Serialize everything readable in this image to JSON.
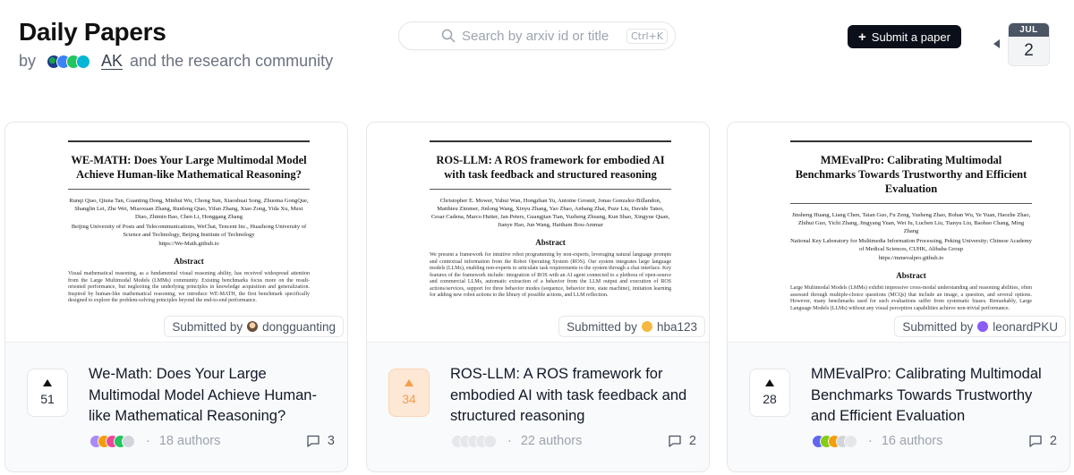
{
  "header": {
    "title": "Daily Papers",
    "by": "by",
    "ak": "AK",
    "community": "and the research community"
  },
  "search": {
    "placeholder": "Search by arxiv id or title",
    "shortcut": "Ctrl+K"
  },
  "submit_button": {
    "label": "Submit a paper"
  },
  "date": {
    "month": "JUL",
    "day": "2"
  },
  "papers": [
    {
      "thumb_title": "WE-MATH: Does Your Large Multimodal Model Achieve Human-like Mathematical Reasoning?",
      "thumb_authors": "Runqi Qiao, Qiuna Tan, Guanting Dong, Minhui Wu, Chong Sun, Xiaoshuai Song, Zhuoma GongQue, Shanglin Lei, Zhe Wei, Miaoxuan Zhang, Runfeng Qiao, Yifan Zhang, Xiao Zong, Yida Xu, Muxi Diao, Zhimin Bao, Chen Li, Honggang Zhang",
      "thumb_affil": "Beijing University of Posts and Telecommunications, WeChat, Tencent Inc., Huazhong University of Science and Technology, Beijing Institute of Technology",
      "thumb_link": "https://We-Math.github.io",
      "thumb_abstract_heading": "Abstract",
      "thumb_abstract": "Visual mathematical reasoning, as a fundamental visual reasoning ability, has received widespread attention from the Large Multimodal Models (LMMs) community. Existing benchmarks focus more on the result-oriented performance, but neglecting the underlying principles in knowledge acquisition and generalization. Inspired by human-like mathematical reasoning, we introduce WE-MATH, the first benchmark specifically designed to explore the problem-solving principles beyond the end-to-end performance.",
      "submitted_label": "Submitted by",
      "submitter": "dongguanting",
      "upvotes": "51",
      "title": "We-Math: Does Your Large Multimodal Model Achieve Human-like Mathematical Reasoning?",
      "authors": "18 authors",
      "comments": "3",
      "voted": false
    },
    {
      "thumb_title": "ROS-LLM: A ROS framework for embodied AI with task feedback and structured reasoning",
      "thumb_authors": "Christopher E. Mower, Yuhui Wan, Hongzhan Yu, Antoine Grosnit, Jonas Gonzalez-Billandon, Matthieu Zimmer, Jinlong Wang, Xinyu Zhang, Yao Zhao, Anbang Zhai, Puze Liu, Davide Tateo, Cesar Cadena, Marco Hutter, Jan Peters, Guangjian Tian, Yuzheng Zhuang, Kun Shao, Xingyue Quan, Jianye Hao, Jun Wang, Haitham Bou-Ammar",
      "thumb_affil": "",
      "thumb_link": "",
      "thumb_abstract_heading": "Abstract",
      "thumb_abstract": "We present a framework for intuitive robot programming by non-experts, leveraging natural language prompts and contextual information from the Robot Operating System (ROS). Our system integrates large language models (LLMs), enabling non-experts to articulate task requirements to the system through a chat interface. Key features of the framework include: integration of ROS with an AI agent connected to a plethora of open-source and commercial LLMs, automatic extraction of a behavior from the LLM output and execution of ROS actions/services, support for three behavior modes (sequence, behavior tree, state machine), imitation learning for adding new robot actions to the library of possible actions, and LLM reflection.",
      "submitted_label": "Submitted by",
      "submitter": "hba123",
      "upvotes": "34",
      "title": "ROS-LLM: A ROS framework for embodied AI with task feedback and structured reasoning",
      "authors": "22 authors",
      "comments": "2",
      "voted": true
    },
    {
      "thumb_title": "MMEvalPro: Calibrating Multimodal Benchmarks Towards Trustworthy and Efficient Evaluation",
      "thumb_authors": "Jinsheng Huang, Liang Chen, Taian Guo, Fu Zeng, Yusheng Zhao, Bohan Wu, Ye Yuan, Haozhe Zhao, Zhihui Guo, Yichi Zhang, Jingyang Yuan, Wei Ju, Luchen Liu, Tianyu Liu, Baobao Chang, Ming Zhang",
      "thumb_affil": "National Key Laboratory for Multimedia Information Processing, Peking University; Chinese Academy of Medical Sciences, CUHK, Alibaba Group",
      "thumb_link": "https://mmevalpro.github.io",
      "thumb_abstract_heading": "Abstract",
      "thumb_abstract": "Large Multimodal Models (LMMs) exhibit impressive cross-modal understanding and reasoning abilities, often assessed through multiple-choice questions (MCQs) that include an image, a question, and several options. However, many benchmarks used for such evaluations suffer from systematic biases. Remarkably, Large Language Models (LLMs) without any visual perception capabilities achieve non-trivial performance.",
      "submitted_label": "Submitted by",
      "submitter": "leonardPKU",
      "upvotes": "28",
      "title": "MMEvalPro: Calibrating Multimodal Benchmarks Towards Trustworthy and Efficient Evaluation",
      "authors": "16 authors",
      "comments": "2",
      "voted": false
    }
  ],
  "colors": {
    "accent": "#f59e4a",
    "vote_bg": "#fde7d5",
    "button_bg": "#0b0f19",
    "muted": "#9ca3af"
  },
  "icons": {
    "search": "search-icon",
    "upvote": "upvote-triangle-icon",
    "comment": "comment-bubble-icon",
    "prev": "chevron-left-icon"
  }
}
